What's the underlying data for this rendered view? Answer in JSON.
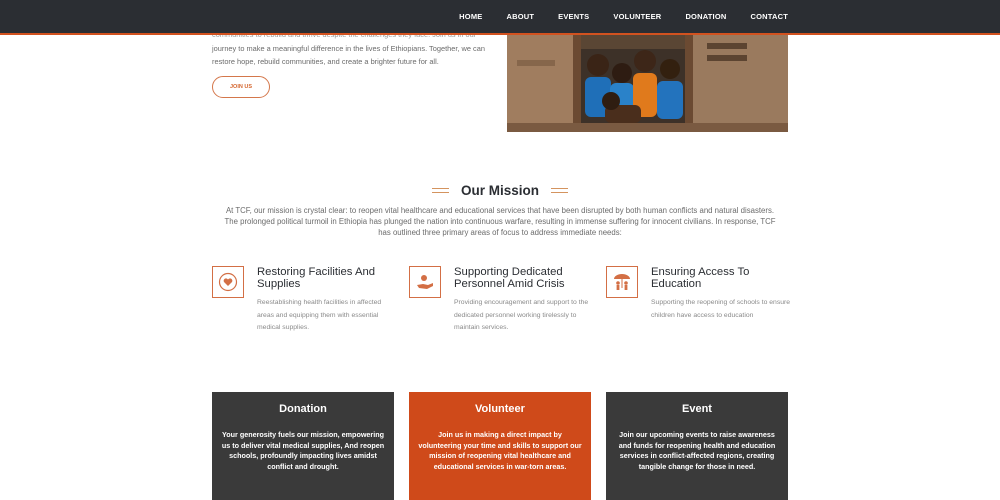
{
  "nav": {
    "items": [
      "HOME",
      "ABOUT",
      "EVENTS",
      "VOLUNTEER",
      "DONATION",
      "CONTACT"
    ]
  },
  "hero": {
    "text_top": "communities to rebuild and thrive despite the challenges they face. Join us in our",
    "text": "journey to make a meaningful difference in the lives of Ethiopians. Together, we can restore hope, rebuild communities, and create a brighter future for all.",
    "join_label": "JOIN US",
    "photo_icon": "children-at-window-photo"
  },
  "mission": {
    "title": "Our Mission",
    "description": "At TCF, our mission is crystal clear: to reopen vital healthcare and educational services that have been disrupted by both human conflicts and natural disasters. The prolonged political turmoil in Ethiopia has plunged the nation into continuous warfare, resulting in immense suffering for innocent civilians. In response, TCF has outlined three primary areas of focus to address immediate needs:"
  },
  "focus_areas": [
    {
      "title": "Restoring Facilities And Supplies",
      "description": "Reestablishing health facilities in affected areas and equipping them with essential medical supplies.",
      "icon": "heart-hands-icon"
    },
    {
      "title": "Supporting Dedicated Personnel Amid Crisis",
      "description": "Providing encouragement and support to the dedicated personnel working tirelessly to maintain services.",
      "icon": "helping-hand-icon"
    },
    {
      "title": "Ensuring Access To Education",
      "description": "Supporting the reopening of schools to ensure children have access to education",
      "icon": "children-umbrella-icon"
    }
  ],
  "cards": [
    {
      "title": "Donation",
      "text": "Your generosity fuels our mission, empowering us to deliver vital medical supplies, And reopen schools, profoundly impacting lives amidst conflict and drought.",
      "color": "#3a3a3a"
    },
    {
      "title": "Volunteer",
      "text": "Join us in making a direct impact by volunteering your time and skills to support our mission of reopening vital healthcare and educational services in war-torn areas.",
      "color": "#cf4a1a"
    },
    {
      "title": "Event",
      "text": "Join our upcoming events to raise awareness and funds for reopening health and education services in conflict-affected regions, creating tangible change for those in need.",
      "color": "#3a3a3a"
    }
  ],
  "colors": {
    "accent": "#d2521f",
    "dark": "#2b2e33"
  }
}
